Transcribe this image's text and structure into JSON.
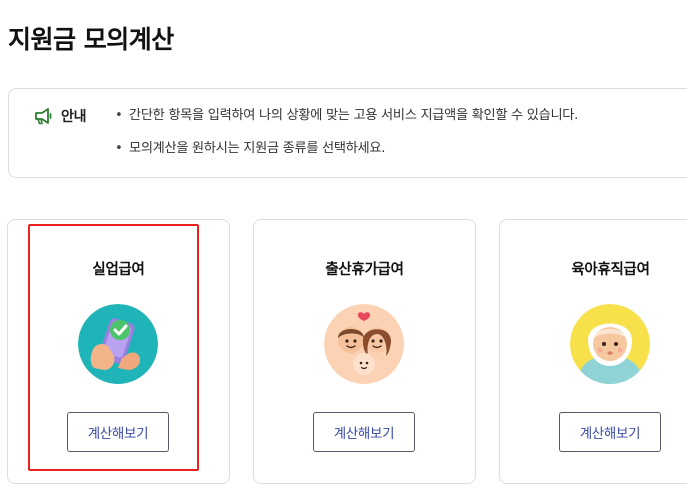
{
  "page": {
    "title": "지원금 모의계산"
  },
  "notice": {
    "icon": "megaphone-icon",
    "label": "안내",
    "lines": [
      "간단한 항목을 입력하여 나의 상황에 맞는 고용 서비스 지급액을 확인할 수 있습니다.",
      "모의계산을 원하시는 지원금 종류를 선택하세요."
    ],
    "bullet": "•",
    "accent_color": "#2e7d32"
  },
  "cards": [
    {
      "title": "실업급여",
      "image": "phone-check-illustration",
      "image_bg": "#1fb5b8",
      "button_label": "계산해보기",
      "highlighted": true
    },
    {
      "title": "출산휴가급여",
      "image": "parents-baby-illustration",
      "image_bg": "#fbd3b4",
      "button_label": "계산해보기",
      "highlighted": false
    },
    {
      "title": "육아휴직급여",
      "image": "baby-illustration",
      "image_bg": "#f7e04a",
      "button_label": "계산해보기",
      "highlighted": false
    }
  ],
  "colors": {
    "highlight": "#e8231f",
    "button_text": "#3a4aa8",
    "card_border": "#dddddd"
  }
}
